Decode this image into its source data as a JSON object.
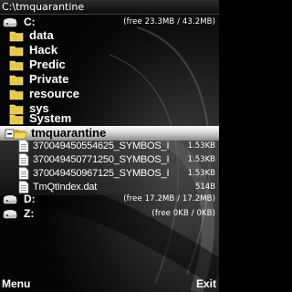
{
  "path_bar": {
    "path": "C:\\tmquarantine"
  },
  "drives": {
    "c": {
      "label": "C:",
      "info": "(free 23.3MB / 43.2MB)"
    },
    "d": {
      "label": "D:",
      "info": "(free 17.2MB / 17.2MB)"
    },
    "z": {
      "label": "Z:",
      "info": "(free 0KB / 0KB)"
    }
  },
  "folders": [
    {
      "label": "data"
    },
    {
      "label": "Hack"
    },
    {
      "label": "Predic"
    },
    {
      "label": "Private"
    },
    {
      "label": "resource"
    },
    {
      "label": "sys"
    },
    {
      "label": "System"
    },
    {
      "label": "tmquarantine"
    }
  ],
  "files": [
    {
      "name": "370049450554625_SYMBOS_I",
      "size": "1.53KB"
    },
    {
      "name": "370049450771250_SYMBOS_I",
      "size": "1.53KB"
    },
    {
      "name": "370049450967125_SYMBOS_I",
      "size": "1.53KB"
    },
    {
      "name": "TmQtIndex.dat",
      "size": "514B"
    }
  ],
  "softkeys": {
    "left": "Menu",
    "right": "Exit"
  },
  "colors": {
    "folder": "#e8c84a",
    "selection_top": "#ffffff",
    "selection_bottom": "#8c8c8c",
    "text": "#ffffff"
  },
  "icons": {
    "drive": "drive-icon",
    "folder": "folder-icon",
    "open_folder": "open-folder-icon",
    "file": "file-icon",
    "expanded": "minus-icon"
  }
}
